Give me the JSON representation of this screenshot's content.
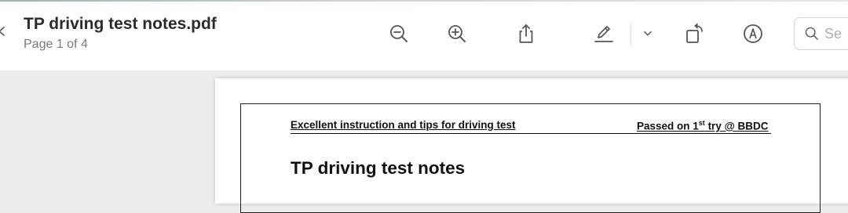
{
  "window": {
    "title": "TP driving test notes.pdf",
    "subtitle": "Page 1 of 4"
  },
  "toolbar": {
    "icons": [
      "zoom-out-icon",
      "zoom-in-icon",
      "share-icon",
      "highlight-icon",
      "chevron-down-icon",
      "rotate-icon",
      "markup-icon",
      "search-icon"
    ],
    "search_placeholder": "Se"
  },
  "document": {
    "header_left": "Excellent instruction and tips for driving test",
    "header_right_prefix": "Passed on 1",
    "header_right_sup": "st",
    "header_right_suffix": " try @ BBDC",
    "heading": "TP driving test notes"
  },
  "colors": {
    "toolbar_bg": "#ffffff",
    "viewer_bg": "#ececec",
    "icon": "#555555"
  }
}
